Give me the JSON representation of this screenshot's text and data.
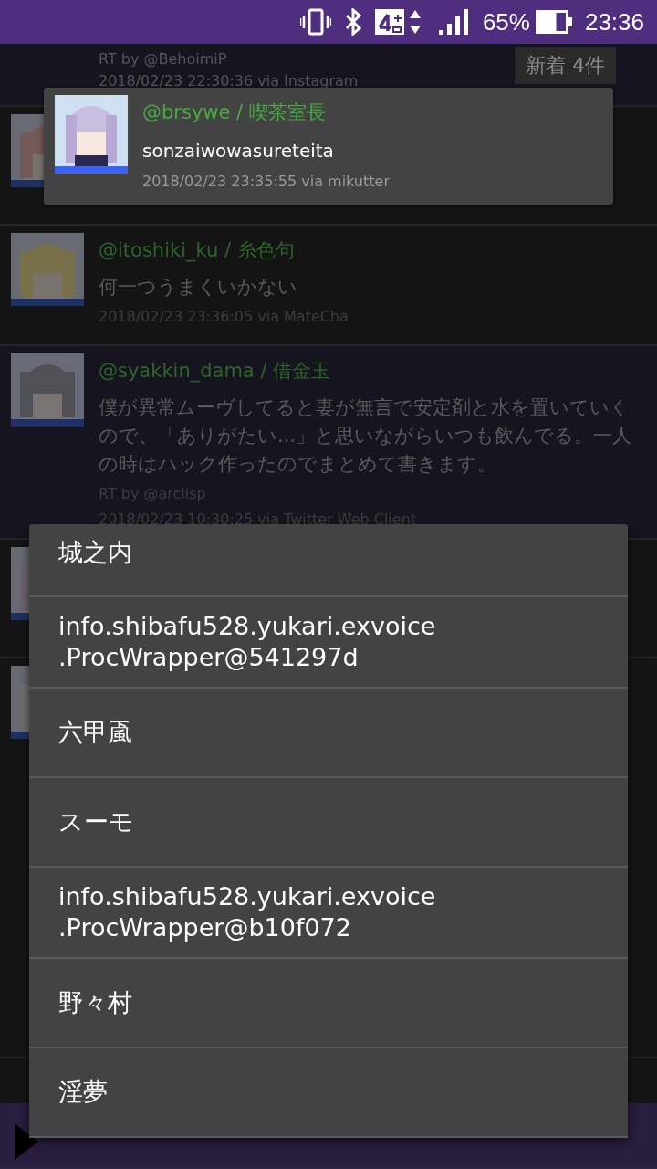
{
  "status_bar": {
    "battery": "65%",
    "time": "23:36"
  },
  "timeline": [
    {
      "kind": "retweet",
      "retweeted_by": "RT by @BehoimiP",
      "meta": "2018/02/23 22:30:36 via Instagram"
    },
    {
      "kind": "tweet"
    },
    {
      "kind": "tweet",
      "user": "@itoshiki_ku / 糸色句",
      "text": "何一つうまくいかない",
      "meta": "2018/02/23 23:36:05 via MateCha"
    },
    {
      "kind": "retweet",
      "user": "@syakkin_dama / 借金玉",
      "text": "僕が異常ムーヴしてると妻が無言で安定剤と水を置いていくので、「ありがたい...」と思いながらいつも飲んでる。一人の時はハック作ったのでまとめて書きます。",
      "retweeted_by": "RT by @arclisp",
      "meta": "2018/02/23 10:30:25 via Twitter Web Client"
    },
    {
      "kind": "tweet"
    },
    {
      "kind": "tweet"
    },
    {
      "kind": "tweet"
    }
  ],
  "new_tweets_button": "新着 4件",
  "notification": {
    "user": "@brsywe / 喫茶室長",
    "text": "sonzaiwowasureteita",
    "meta": "2018/02/23 23:35:55 via mikutter"
  },
  "menu": {
    "items": [
      "城之内",
      "info.shibafu528.yukari.exvoice\n.ProcWrapper@541297d",
      "六甲颪",
      "スーモ",
      "info.shibafu528.yukari.exvoice\n.ProcWrapper@b10f072",
      "野々村",
      "淫夢"
    ]
  }
}
